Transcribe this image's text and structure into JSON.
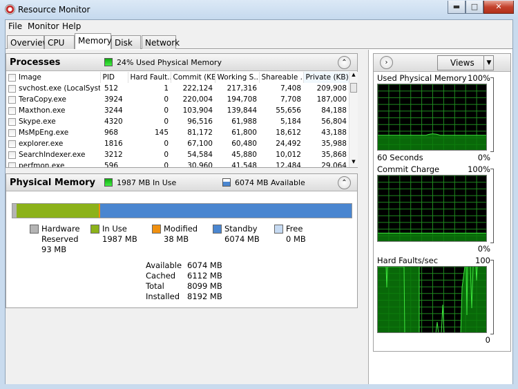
{
  "window": {
    "title": "Resource Monitor",
    "controls": [
      "minimize",
      "maximize",
      "close"
    ]
  },
  "menu": [
    "File",
    "Monitor",
    "Help"
  ],
  "tabs": [
    {
      "label": "Overview"
    },
    {
      "label": "CPU"
    },
    {
      "label": "Memory",
      "active": true
    },
    {
      "label": "Disk"
    },
    {
      "label": "Network"
    }
  ],
  "processes": {
    "title": "Processes",
    "status": "24% Used Physical Memory",
    "columns": [
      "Image",
      "PID",
      "Hard Fault...",
      "Commit (KB)",
      "Working S...",
      "Shareable ...",
      "Private (KB)"
    ],
    "sorted_column": "Private (KB)",
    "rows": [
      [
        "svchost.exe (LocalSyste...",
        "512",
        "1",
        "222,124",
        "217,316",
        "7,408",
        "209,908"
      ],
      [
        "TeraCopy.exe",
        "3924",
        "0",
        "220,004",
        "194,708",
        "7,708",
        "187,000"
      ],
      [
        "Maxthon.exe",
        "3244",
        "0",
        "103,904",
        "139,844",
        "55,656",
        "84,188"
      ],
      [
        "Skype.exe",
        "4320",
        "0",
        "96,516",
        "61,988",
        "5,184",
        "56,804"
      ],
      [
        "MsMpEng.exe",
        "968",
        "145",
        "81,172",
        "61,800",
        "18,612",
        "43,188"
      ],
      [
        "explorer.exe",
        "1816",
        "0",
        "67,100",
        "60,480",
        "24,492",
        "35,988"
      ],
      [
        "SearchIndexer.exe",
        "3212",
        "0",
        "54,584",
        "45,880",
        "10,012",
        "35,868"
      ],
      [
        "perfmon.exe",
        "596",
        "0",
        "30,960",
        "41,548",
        "12,484",
        "29,064"
      ]
    ]
  },
  "physical": {
    "title": "Physical Memory",
    "in_use": "1987 MB In Use",
    "available": "6074 MB Available",
    "bar": {
      "hardware_mb": 93,
      "in_use_mb": 1987,
      "modified_mb": 38,
      "standby_mb": 6074,
      "free_mb": 0
    },
    "legend": [
      {
        "name": "Hardware",
        "sub": "Reserved",
        "value": "93 MB",
        "color": "#b4b4b4"
      },
      {
        "name": "In Use",
        "value": "1987 MB",
        "color": "#8cb21a"
      },
      {
        "name": "Modified",
        "value": "38 MB",
        "color": "#f0900f"
      },
      {
        "name": "Standby",
        "value": "6074 MB",
        "color": "#4a86d0"
      },
      {
        "name": "Free",
        "value": "0 MB",
        "color": "#c6daf2"
      }
    ],
    "stats": [
      [
        "Available",
        "6074 MB"
      ],
      [
        "Cached",
        "6112 MB"
      ],
      [
        "Total",
        "8099 MB"
      ],
      [
        "Installed",
        "8192 MB"
      ]
    ]
  },
  "graphs": {
    "views_label": "Views",
    "used": {
      "title": "Used Physical Memory",
      "max": "100%",
      "min": "0%",
      "time": "60 Seconds",
      "level_percent": 24
    },
    "commit": {
      "title": "Commit Charge",
      "max": "100%",
      "min": "0%",
      "level_percent": 14
    },
    "faults": {
      "title": "Hard Faults/sec",
      "max": "100",
      "min": "0"
    }
  },
  "colors": {
    "graph_line": "#3ee83e",
    "graph_fill": "#0b7a0b",
    "grid": "#1f8a1f"
  }
}
